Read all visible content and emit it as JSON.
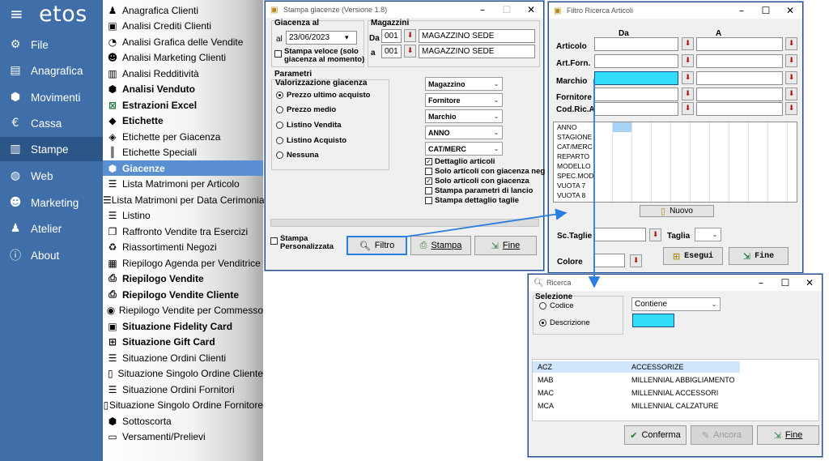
{
  "nav": {
    "logo": "etos",
    "items": [
      {
        "label": "File",
        "icon": "gear-icon"
      },
      {
        "label": "Anagrafica",
        "icon": "database-icon"
      },
      {
        "label": "Movimenti",
        "icon": "cubes-icon"
      },
      {
        "label": "Cassa",
        "icon": "euro-icon"
      },
      {
        "label": "Stampe",
        "icon": "bar-chart-icon"
      },
      {
        "label": "Web",
        "icon": "globe-icon"
      },
      {
        "label": "Marketing",
        "icon": "users-icon"
      },
      {
        "label": "Atelier",
        "icon": "person-icon"
      },
      {
        "label": "About",
        "icon": "info-icon"
      }
    ]
  },
  "menu": {
    "items": [
      {
        "label": "Anagrafica Clienti",
        "icon": "user-icon",
        "bold": false
      },
      {
        "label": "Analisi Crediti Clienti",
        "icon": "id-card-icon",
        "bold": false
      },
      {
        "label": "Analisi Grafica delle Vendite",
        "icon": "pie-chart-icon",
        "bold": false
      },
      {
        "label": "Analisi Marketing Clienti",
        "icon": "users-icon",
        "bold": false
      },
      {
        "label": "Analisi Redditività",
        "icon": "bar-chart-icon",
        "bold": false
      },
      {
        "label": "Analisi Venduto",
        "icon": "cubes-icon",
        "bold": true
      },
      {
        "label": "Estrazioni Excel",
        "icon": "excel-icon",
        "bold": true
      },
      {
        "label": "Etichette",
        "icon": "tag-icon",
        "bold": true
      },
      {
        "label": "Etichette per Giacenza",
        "icon": "tags-icon",
        "bold": false
      },
      {
        "label": "Etichette Speciali",
        "icon": "barcode-icon",
        "bold": false
      },
      {
        "label": "Giacenze",
        "icon": "cubes-icon",
        "bold": true
      },
      {
        "label": "Lista Matrimoni per Articolo",
        "icon": "list-icon",
        "bold": false
      },
      {
        "label": "Lista Matrimoni per Data Cerimonia",
        "icon": "list-icon",
        "bold": false
      },
      {
        "label": "Listino",
        "icon": "list-icon",
        "bold": false
      },
      {
        "label": "Raffronto Vendite tra Esercizi",
        "icon": "copy-icon",
        "bold": false
      },
      {
        "label": "Riassortimenti Negozi",
        "icon": "recycle-icon",
        "bold": false
      },
      {
        "label": "Riepilogo Agenda per Venditrice",
        "icon": "calendar-icon",
        "bold": false
      },
      {
        "label": "Riepilogo Vendite",
        "icon": "print-icon",
        "bold": true
      },
      {
        "label": "Riepilogo Vendite Cliente",
        "icon": "print-icon",
        "bold": true
      },
      {
        "label": "Riepilogo Vendite per Commesso",
        "icon": "user-circle-icon",
        "bold": false
      },
      {
        "label": "Situazione Fidelity Card",
        "icon": "id-card-icon",
        "bold": true
      },
      {
        "label": "Situazione Gift Card",
        "icon": "gift-icon",
        "bold": true
      },
      {
        "label": "Situazione Ordini Clienti",
        "icon": "list-icon",
        "bold": false
      },
      {
        "label": "Situazione Singolo Ordine Cliente",
        "icon": "document-icon",
        "bold": false
      },
      {
        "label": "Situazione Ordini Fornitori",
        "icon": "list-icon",
        "bold": false
      },
      {
        "label": "Situazione Singolo Ordine Fornitore",
        "icon": "document-icon",
        "bold": false
      },
      {
        "label": "Sottoscorta",
        "icon": "cubes-icon",
        "bold": false
      },
      {
        "label": "Versamenti/Prelievi",
        "icon": "money-icon",
        "bold": false
      }
    ],
    "selected": "Giacenze"
  },
  "stampa": {
    "title": "Stampa giacenze (Versione 1.8)",
    "giacenza_al": "Giacenza al",
    "al": "al",
    "date": "23/06/2023",
    "stampa_veloce": "Stampa veloce (solo giacenza al momento)",
    "magazzini": "Magazzini",
    "da": "Da",
    "a": "a",
    "mag_da_code": "001",
    "mag_da_name": "MAGAZZINO SEDE",
    "mag_a_code": "001",
    "mag_a_name": "MAGAZZINO SEDE",
    "parametri": "Parametri",
    "valorizzazione": "Valorizzazione giacenza",
    "radios": [
      "Prezzo ultimo acquisto",
      "Prezzo medio",
      "Listino Vendita",
      "Listino Acquisto",
      "Nessuna"
    ],
    "combos": [
      "Magazzino",
      "Fornitore",
      "Marchio",
      "ANNO",
      "CAT/MERC"
    ],
    "checks": [
      {
        "label": "Dettaglio articoli",
        "checked": true
      },
      {
        "label": "Solo articoli con giacenza neg",
        "checked": false
      },
      {
        "label": "Solo articoli con giacenza",
        "checked": true
      },
      {
        "label": "Stampa parametri di lancio",
        "checked": false
      },
      {
        "label": "Stampa dettaglio taglie",
        "checked": false
      }
    ],
    "stampa_pers": "Stampa Personalizzata",
    "btn_filtro": "Filtro",
    "btn_stampa": "Stampa",
    "btn_fine": "Fine"
  },
  "filtro": {
    "title": "Filtro Ricerca Articoli",
    "col_da": "Da",
    "col_a": "A",
    "rows": [
      "Articolo",
      "Art.Forn.",
      "Marchio",
      "Fornitore",
      "Cod.Ric.Alt"
    ],
    "grid_rows": [
      "ANNO",
      "STAGIONE",
      "CAT/MERC",
      "REPARTO",
      "MODELLO",
      "SPEC.MOD.",
      "VUOTA 7",
      "VUOTA 8"
    ],
    "btn_nuovo": "Nuovo",
    "sc_taglie": "Sc.Taglie",
    "taglia": "Taglia",
    "colore": "Colore",
    "btn_esegui": "Esegui",
    "btn_fine": "Fine"
  },
  "ricerca": {
    "title": "Ricerca",
    "selezione": "Selezione",
    "opt_codice": "Codice",
    "opt_descrizione": "Descrizione",
    "combo": "Contiene",
    "rows": [
      {
        "code": "ACZ",
        "desc": "ACCESSORIZE"
      },
      {
        "code": "MAB",
        "desc": "MILLENNIAL ABBIGLIAMENTO"
      },
      {
        "code": "MAC",
        "desc": "MILLENNIAL ACCESSORI"
      },
      {
        "code": "MCA",
        "desc": "MILLENNIAL CALZATURE"
      }
    ],
    "btn_conferma": "Conferma",
    "btn_ancora": "Ancora",
    "btn_fine": "Fine"
  },
  "colors": {
    "nav_bg": "#3f6ea8",
    "menu_selected": "#5a8fd2",
    "highlight_cyan": "#33ddf7",
    "arrow": "#2a7de1"
  }
}
